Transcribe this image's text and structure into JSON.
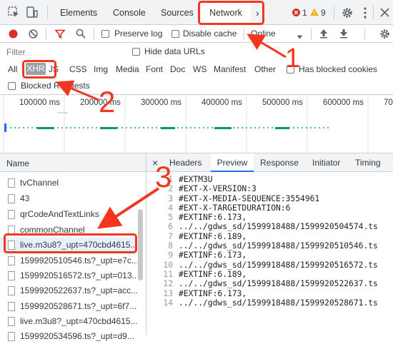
{
  "topbar": {
    "tabs": [
      "Elements",
      "Console",
      "Sources",
      "Network"
    ],
    "more_tabs": "›",
    "error_count": "1",
    "warning_count": "9"
  },
  "toolbar": {
    "preserve_log": "Preserve log",
    "disable_cache": "Disable cache",
    "throttling": "Online"
  },
  "filter": {
    "placeholder": "Filter",
    "hide_data_urls": "Hide data URLs"
  },
  "types": [
    "All",
    "XHR",
    "JS",
    "CSS",
    "Img",
    "Media",
    "Font",
    "Doc",
    "WS",
    "Manifest",
    "Other"
  ],
  "has_blocked_cookies": "Has blocked cookies",
  "blocked_requests": "Blocked Requests",
  "timeline": {
    "ticks": [
      "100000 ms",
      "200000 ms",
      "300000 ms",
      "400000 ms",
      "500000 ms",
      "600000 ms",
      "70"
    ]
  },
  "request_list": {
    "header": "Name",
    "rows": [
      "tvChannel",
      "43",
      "qrCodeAndTextLinks",
      "commonChannel",
      "live.m3u8?_upt=470cbd4615...",
      "1599920510546.ts?_upt=e7c...",
      "1599920516572.ts?_upt=013...",
      "1599920522637.ts?_upt=acc...",
      "1599920528671.ts?_upt=6f7...",
      "live.m3u8?_upt=470cbd4615...",
      "1599920534596.ts?_upt=d9..."
    ]
  },
  "details": {
    "close": "×",
    "tabs": [
      "Headers",
      "Preview",
      "Response",
      "Initiator",
      "Timing"
    ],
    "lines": [
      "#EXTM3U",
      "#EXT-X-VERSION:3",
      "#EXT-X-MEDIA-SEQUENCE:3554961",
      "#EXT-X-TARGETDURATION:6",
      "#EXTINF:6.173,",
      "../../gdws_sd/1599918488/1599920504574.ts",
      "#EXTINF:6.189,",
      "../../gdws_sd/1599918488/1599920510546.ts",
      "#EXTINF:6.173,",
      "../../gdws_sd/1599918488/1599920516572.ts",
      "#EXTINF:6.189,",
      "../../gdws_sd/1599918488/1599920522637.ts",
      "#EXTINF:6.173,",
      "../../gdws_sd/1599918488/1599920528671.ts"
    ]
  },
  "annotations": [
    "1",
    "2",
    "3"
  ],
  "colors": {
    "accent": "#1a73e8",
    "annotation_red": "#f4361e",
    "record_red": "#d93025",
    "warning": "#f2a600"
  }
}
